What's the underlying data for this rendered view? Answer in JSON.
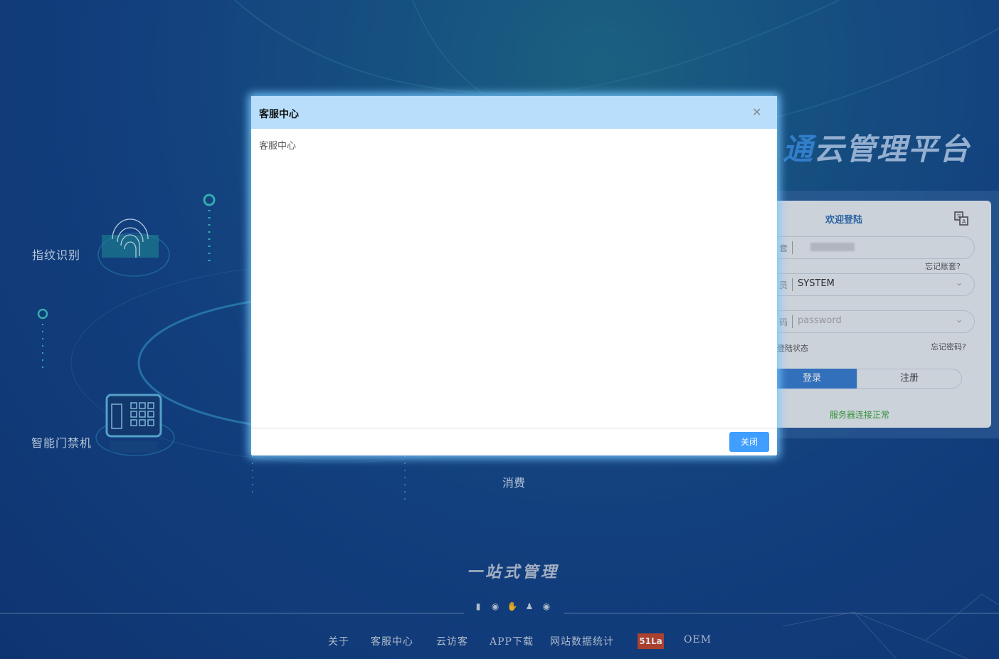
{
  "background": {
    "features": [
      {
        "label": "指纹识别"
      },
      {
        "label": "智能门禁机"
      },
      {
        "label": "消费"
      }
    ],
    "brand_title_left": "通",
    "brand_title_right": "云管理平台",
    "slogan": "一站式管理"
  },
  "login": {
    "title": "欢迎登陆",
    "account_prefix": "套",
    "forgot_account": "忘记账套?",
    "user_prefix": "员",
    "user_value": "SYSTEM",
    "password_prefix": "码",
    "password_placeholder": "password",
    "remember_label": "登陆状态",
    "forgot_password": "忘记密码?",
    "login_button": "登录",
    "register_button": "注册",
    "server_status": "服务器连接正常",
    "colors": {
      "accent": "#3a7fd0",
      "status": "#3aa53a"
    }
  },
  "dialog": {
    "title": "客服中心",
    "body": "客服中心",
    "close_button": "关闭",
    "colors": {
      "header": "#b8defb",
      "button": "#409eff"
    }
  },
  "footer": {
    "icons": [
      "shield-icon",
      "fingerprint-icon",
      "hand-icon",
      "person-icon",
      "eye-icon"
    ],
    "nav": [
      {
        "label": "关于"
      },
      {
        "label": "客服中心"
      },
      {
        "label": "云访客"
      },
      {
        "label": "APP下载"
      },
      {
        "label": "网站数据统计"
      }
    ],
    "badge": "51La",
    "oem": "OEM"
  }
}
